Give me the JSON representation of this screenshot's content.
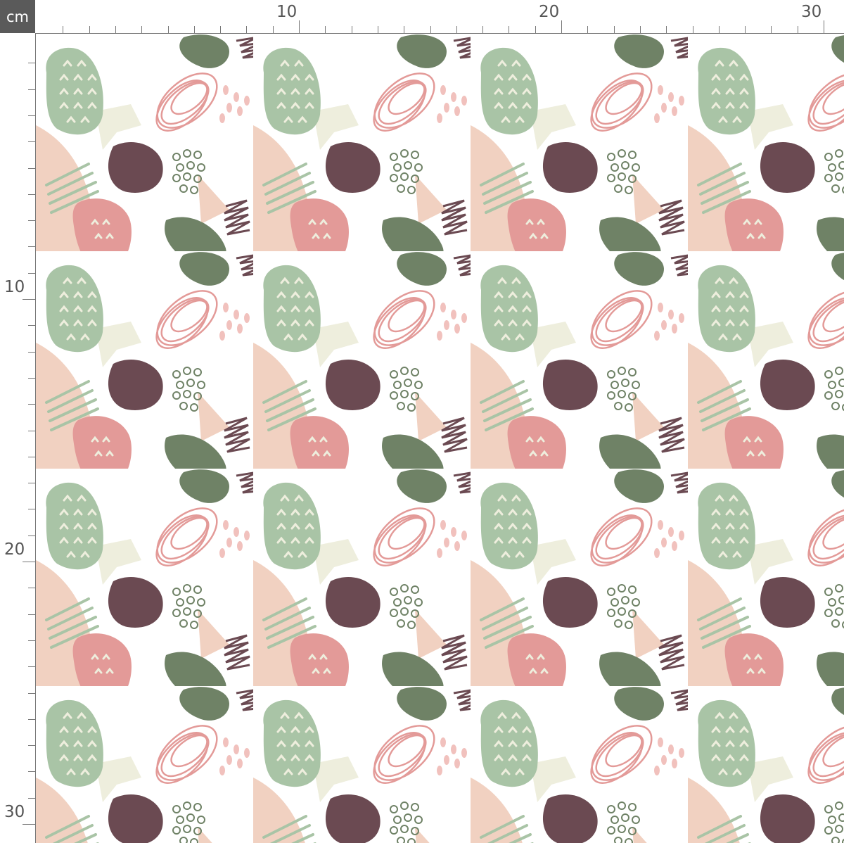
{
  "ruler": {
    "unit": "cm",
    "top_labels": [
      "10",
      "20",
      "30"
    ],
    "left_labels": [
      "10",
      "20",
      "30"
    ]
  },
  "fabric": {
    "background": "#ffffff",
    "palette": {
      "sage": "#a9c4a6",
      "olive": "#6f8266",
      "pink": "#e39a98",
      "plum": "#6b4a52",
      "peach": "#efc9b6",
      "cream": "#eeeedd",
      "light_pink": "#f1c1bd"
    },
    "motifs": [
      "sage-leaf-with-chevrons",
      "pink-scribble-oval",
      "plum-blob",
      "olive-blob",
      "pink-leaf-with-chevrons",
      "plum-zigzag",
      "sage-hatch-lines",
      "olive-dot-cluster",
      "peach-arc-shape"
    ]
  }
}
